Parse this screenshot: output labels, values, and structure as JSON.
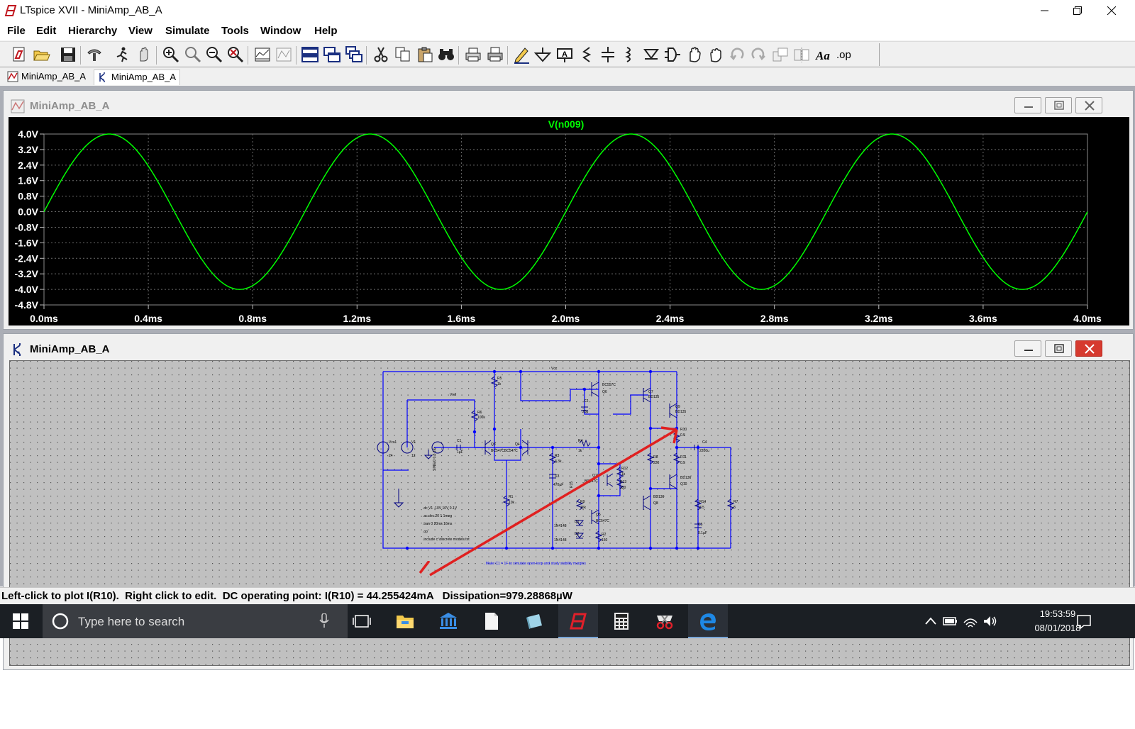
{
  "window": {
    "title": "LTspice XVII - MiniAmp_AB_A",
    "controls": [
      "minimize",
      "maximize",
      "close"
    ]
  },
  "menu": [
    "File",
    "Edit",
    "Hierarchy",
    "View",
    "Simulate",
    "Tools",
    "Window",
    "Help"
  ],
  "toolbar_icons": [
    "new-schematic-icon",
    "open-icon",
    "save-icon",
    "control-panel-icon",
    "run-icon",
    "halt-icon",
    "zoom-in-icon",
    "zoom-full-icon",
    "zoom-out-icon",
    "zoom-cancel-icon",
    "autorange-icon",
    "mark-unused-icon",
    "tile-horizontal-icon",
    "tile-vertical-icon",
    "cascade-icon",
    "cut-icon",
    "copy-icon",
    "paste-icon",
    "find-icon",
    "print-setup-icon",
    "print-icon",
    "draw-wire-icon",
    "ground-icon",
    "label-net-icon",
    "resistor-icon",
    "capacitor-icon",
    "inductor-icon",
    "diode-icon",
    "component-icon",
    "move-icon",
    "drag-icon",
    "undo-icon",
    "redo-icon",
    "rotate-icon",
    "mirror-icon",
    "text-icon",
    "spice-directive-icon"
  ],
  "tabs": [
    {
      "label": "MiniAmp_AB_A",
      "icon": "waveform-icon",
      "active": false
    },
    {
      "label": "MiniAmp_AB_A",
      "icon": "schematic-icon",
      "active": true
    }
  ],
  "waveform_window": {
    "title": "MiniAmp_AB_A",
    "trace_color": "#00ff00"
  },
  "schematic_window": {
    "title": "MiniAmp_AB_A",
    "wire_color": "#0000ff",
    "arrow_color": "#e02020"
  },
  "chart_data": {
    "type": "line",
    "title": "V(n009)",
    "series": [
      {
        "name": "V(n009)",
        "color": "#00ff00",
        "waveform": "sine",
        "amplitude": 4.0,
        "frequency_hz": 1000,
        "phase_deg": 0
      }
    ],
    "x_range": [
      0.0,
      4.0
    ],
    "x_unit": "ms",
    "xticks": [
      "0.0ms",
      "0.4ms",
      "0.8ms",
      "1.2ms",
      "1.6ms",
      "2.0ms",
      "2.4ms",
      "2.8ms",
      "3.2ms",
      "3.6ms",
      "4.0ms"
    ],
    "y_range": [
      -4.8,
      4.0
    ],
    "yticks": [
      "4.0V",
      "3.2V",
      "2.4V",
      "1.6V",
      "0.8V",
      "0.0V",
      "-0.8V",
      "-1.6V",
      "-2.4V",
      "-3.2V",
      "-4.0V",
      "-4.8V"
    ],
    "grid": true
  },
  "schematic": {
    "labels": {
      "vcc": "Vcc",
      "vref": "Vref",
      "r5": "R5",
      "r5v": "1k",
      "r6": "R6",
      "r6v": "100k",
      "q3": "Q3",
      "q4": "Q4",
      "q34v": "BC547CBC547C",
      "q6": "Q6",
      "q6v": "BC557C",
      "c2": "C2",
      "c2v": "20p",
      "q7": "Q7",
      "q7v": "BD135",
      "q9": "Q9",
      "q9v": "BD135",
      "r10": "R10",
      "r10v": "0.5",
      "r11": "R11",
      "r11v": "0.5",
      "c4": "C4",
      "c4v": "2200u",
      "r8": "R8",
      "r8v": "220",
      "r12": "R12",
      "r12v": "1k",
      "r13": "R13",
      "r13v": "330",
      "q11": "Q11",
      "q11v": "BC547C",
      "q10": "Q10",
      "q10v": "BD136",
      "q8": "Q8",
      "q8v": "BD136",
      "r3": "R3",
      "r3v": "3.3k",
      "c3": "C3",
      "c3v": "470µF",
      "r4": "R4",
      "r4v": "1k",
      "r1": "R1",
      "r1v": "10k",
      "r14": "R14",
      "r14v": "8.5",
      "r7": "R7",
      "r7v": "8",
      "c5": "C5",
      "c5v": "0.1µF",
      "q5": "Q5",
      "q5v": "BC547C",
      "r2": "R2",
      "r2v": "150",
      "d1": "D1",
      "d2": "D2",
      "d1v": "1N4148",
      "d2v": "1N4148",
      "vcc1": "Vcc1",
      "vcc1v": "24",
      "v1": "V1",
      "v1v": "12",
      "c1": "C1",
      "c1v": "1µF",
      "v2src": "SINE(0 0.5 1k)",
      "r9": "R9",
      "r9v": "15k",
      "r15": "R15"
    },
    "directives": [
      ".dc V1 -10V 10V 0.1V",
      ".ac dec 20 1 1meg",
      ".tran 0 20ms 16ms",
      ".op",
      ".include c:\\discrete models.txt"
    ],
    "note": ". Make C1 = 1F to simulate open-loop and study stability margins"
  },
  "status_text": "Left-click to plot I(R10).  Right click to edit.  DC operating point: I(R10) = 44.255424mA   Dissipation=979.28868µW",
  "taskbar": {
    "search_placeholder": "Type here to search",
    "time": "19:53:59",
    "date": "08/01/2018",
    "apps": [
      "task-view-icon",
      "file-explorer-icon",
      "bank-icon",
      "document-icon",
      "notepad-icon",
      "ltspice-icon",
      "calculator-icon",
      "snipping-icon",
      "edge-icon"
    ]
  }
}
